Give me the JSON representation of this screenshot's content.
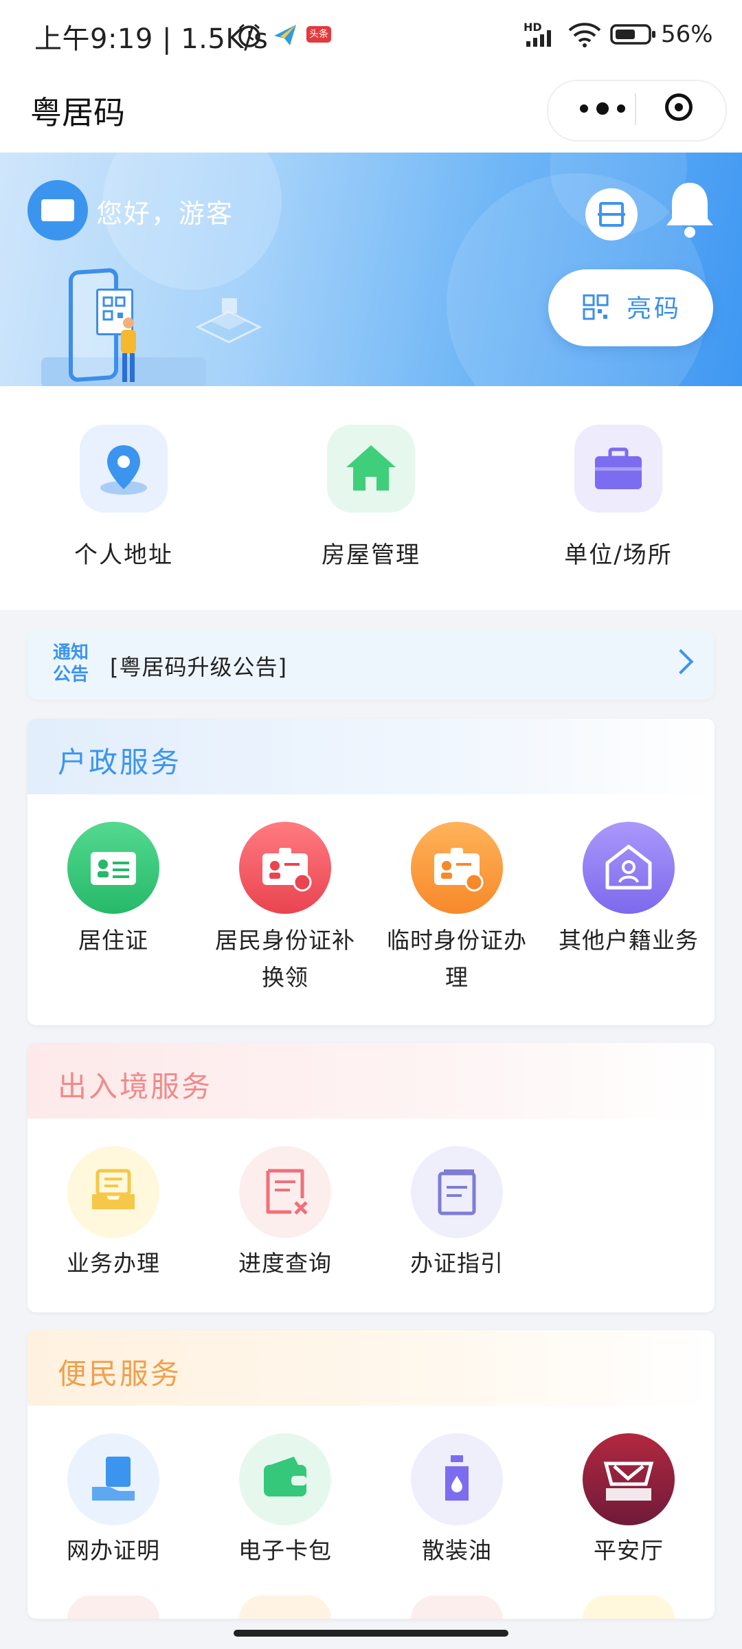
{
  "status_bar": {
    "time": "上午9:19 | 1.5K/s",
    "badge": "头条",
    "network": "HD",
    "battery": "56%"
  },
  "title_bar": {
    "title": "粤居码",
    "more_icon": "more-dots-icon",
    "close_icon": "target-icon"
  },
  "banner": {
    "greeting": "您好，游客",
    "bright_code_label": "亮码"
  },
  "shortcuts": [
    {
      "label": "个人地址",
      "icon": "location-icon",
      "color": "#3b95ef"
    },
    {
      "label": "房屋管理",
      "icon": "house-icon",
      "color": "#3fcf7a"
    },
    {
      "label": "单位/场所",
      "icon": "briefcase-icon",
      "color": "#7b6cf0"
    }
  ],
  "notice": {
    "tag_line1": "通知",
    "tag_line2": "公告",
    "text": "[粤居码升级公告]"
  },
  "household_services": {
    "title": "户政服务",
    "title_color": "#3b95ef",
    "items": [
      {
        "label": "居住证",
        "icon": "residence-card-icon",
        "color": "#35c77a"
      },
      {
        "label": "居民身份证补换领",
        "icon": "id-card-replace-icon",
        "color": "#f0585f"
      },
      {
        "label": "临时身份证办理",
        "icon": "temp-id-card-icon",
        "color": "#f99a3c"
      },
      {
        "label": "其他户籍业务",
        "icon": "household-register-icon",
        "color": "#8f7bf0"
      }
    ]
  },
  "immigration_services": {
    "title": "出入境服务",
    "title_color": "#f08a8a",
    "items": [
      {
        "label": "业务办理",
        "icon": "inbox-icon",
        "color": "#f5c84a"
      },
      {
        "label": "进度查询",
        "icon": "document-cross-icon",
        "color": "#f0707a"
      },
      {
        "label": "办证指引",
        "icon": "guide-document-icon",
        "color": "#7f7cd8"
      }
    ]
  },
  "convenience_services": {
    "title": "便民服务",
    "title_color": "#f0a04a",
    "items": [
      {
        "label": "网办证明",
        "icon": "certificate-hand-icon",
        "color": "#3b95ef"
      },
      {
        "label": "电子卡包",
        "icon": "wallet-icon",
        "color": "#35c77a"
      },
      {
        "label": "散装油",
        "icon": "oil-bottle-icon",
        "color": "#7b6cf0"
      },
      {
        "label": "平安厅",
        "icon": "pingan-logo-icon",
        "color": "#8a1f3e"
      }
    ]
  }
}
